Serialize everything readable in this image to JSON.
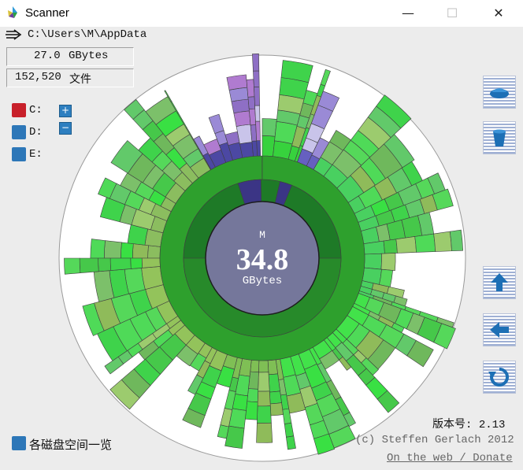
{
  "window": {
    "title": "Scanner",
    "minimize": "—",
    "maximize": "☐",
    "close": "✕"
  },
  "path": {
    "current": "C:\\Users\\M\\AppData"
  },
  "summary": {
    "size_value": "27.0",
    "size_unit": "GBytes",
    "files_value": "152,520",
    "files_unit": "文件"
  },
  "drives": [
    {
      "label": "C:",
      "color": "#c8202a"
    },
    {
      "label": "D:",
      "color": "#2d77b8"
    },
    {
      "label": "E:",
      "color": "#2d77b8"
    }
  ],
  "zoom": {
    "plus": "+",
    "minus": "−"
  },
  "center": {
    "name": "M",
    "value": "34.8",
    "unit": "GBytes"
  },
  "sidebar": {
    "buttons": [
      "drive-icon",
      "trash-icon",
      "up-arrow-icon",
      "back-arrow-icon",
      "refresh-icon"
    ]
  },
  "footer": {
    "version_label": "版本号:",
    "version_value": "2.13",
    "credit": "(c) Steffen Gerlach 2012",
    "link": "On the web / Donate",
    "overview": "各磁盘空间一览"
  },
  "colors": {
    "center_fill": "#75779b",
    "ring_dark": "#217a2a",
    "ring_mid": "#2c9b2e",
    "accent_blue": "#2d77b8"
  }
}
